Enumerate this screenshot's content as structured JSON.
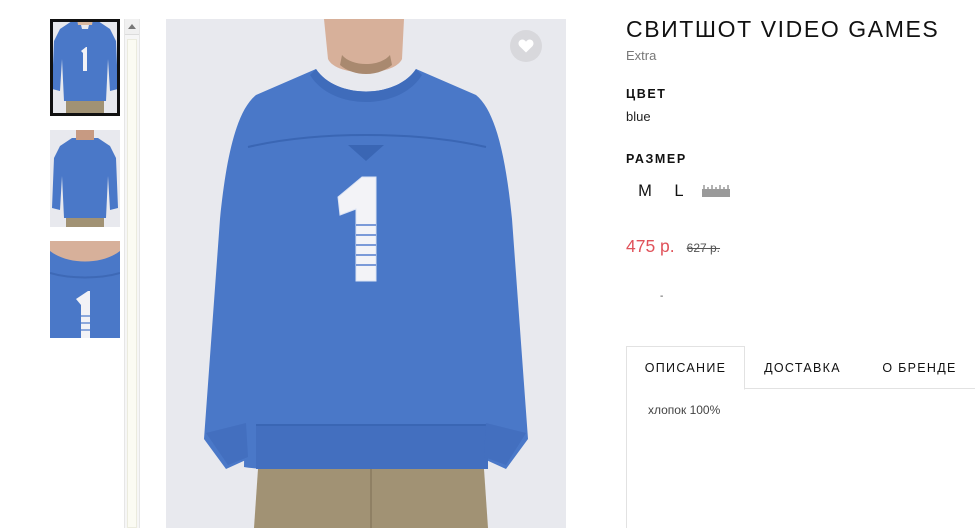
{
  "gallery": {
    "thumbnails": [
      {
        "label": "front-view",
        "active": true
      },
      {
        "label": "back-view",
        "active": false
      },
      {
        "label": "detail-view",
        "active": false
      }
    ]
  },
  "main_image": {
    "favorite_icon": "heart-icon"
  },
  "product": {
    "title": "СВИТШОТ VIDEO GAMES",
    "brand": "Extra",
    "color_label": "ЦВЕТ",
    "color_value": "blue",
    "size_label": "РАЗМЕР",
    "sizes": [
      "M",
      "L"
    ],
    "size_chart_icon": "ruler-icon",
    "price_current": "475 р.",
    "price_old": "627 р.",
    "accent_price_color": "#e0525a",
    "garment_color": "#4a78c8"
  },
  "tabs": {
    "items": [
      "ОПИСАНИЕ",
      "ДОСТАВКА",
      "О БРЕНДЕ"
    ],
    "active_index": 0,
    "description_text": "хлопок 100%"
  },
  "misc": {
    "tiny_mark": "-"
  }
}
